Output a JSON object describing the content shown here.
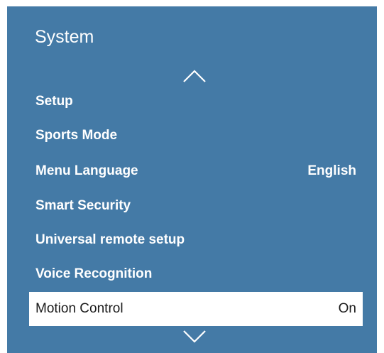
{
  "panel": {
    "title": "System"
  },
  "icons": {
    "scroll_up": "chevron-up-icon",
    "scroll_down": "chevron-down-icon"
  },
  "colors": {
    "panel_background": "#447aa6",
    "text": "#ffffff",
    "focus_background": "#ffffff",
    "focus_text": "#1a1a1a"
  },
  "menu": {
    "items": [
      {
        "label": "Setup",
        "value": ""
      },
      {
        "label": "Sports Mode",
        "value": ""
      },
      {
        "label": "Menu Language",
        "value": "English"
      },
      {
        "label": "Smart Security",
        "value": ""
      },
      {
        "label": "Universal remote setup",
        "value": ""
      },
      {
        "label": "Voice Recognition",
        "value": ""
      },
      {
        "label": "Motion Control",
        "value": "On"
      }
    ],
    "focused_index": 6
  }
}
